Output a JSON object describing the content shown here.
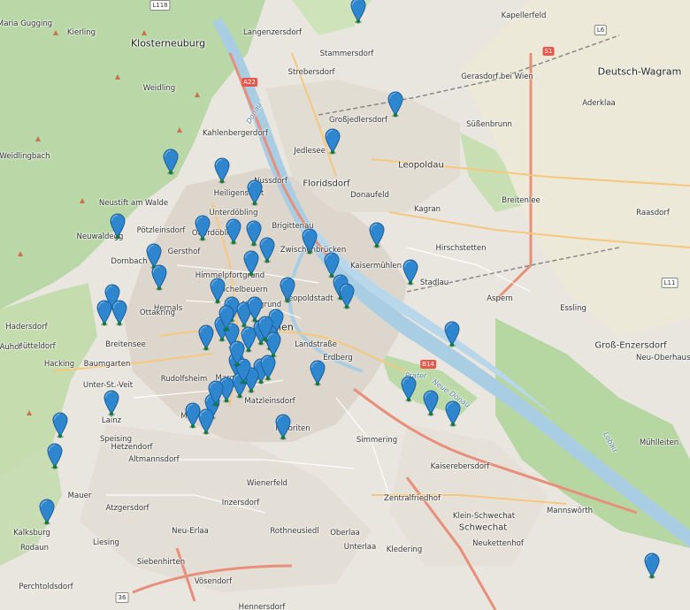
{
  "map": {
    "places": [
      {
        "name": "Maria Gugging",
        "size": "small"
      },
      {
        "name": "Kierling",
        "size": "small"
      },
      {
        "name": "Klosterneuburg",
        "size": "big"
      },
      {
        "name": "Langenzersdorf",
        "size": "small"
      },
      {
        "name": "Kapellerfeld",
        "size": "small"
      },
      {
        "name": "Stammersdorf",
        "size": "small"
      },
      {
        "name": "Strebersdorf",
        "size": "small"
      },
      {
        "name": "Gerasdorf bei Wien",
        "size": "small"
      },
      {
        "name": "Deutsch-Wagram",
        "size": "big"
      },
      {
        "name": "Aderklaa",
        "size": "small"
      },
      {
        "name": "Süßenbrunn",
        "size": "small"
      },
      {
        "name": "Großjedlersdorf",
        "size": "small"
      },
      {
        "name": "Weidling",
        "size": "small"
      },
      {
        "name": "Kahlenbergerdorf",
        "size": "small"
      },
      {
        "name": "Jedlesee",
        "size": "small"
      },
      {
        "name": "Leopoldau",
        "size": "mid"
      },
      {
        "name": "Weidlingbach",
        "size": "small"
      },
      {
        "name": "Neustift am Walde",
        "size": "small"
      },
      {
        "name": "Nussdorf",
        "size": "small"
      },
      {
        "name": "Floridsdorf",
        "size": "mid"
      },
      {
        "name": "Donaufeld",
        "size": "small"
      },
      {
        "name": "Breitenlee",
        "size": "small"
      },
      {
        "name": "Heiligenstadt",
        "size": "small"
      },
      {
        "name": "Unterdöbling",
        "size": "small"
      },
      {
        "name": "Kagran",
        "size": "small"
      },
      {
        "name": "Raasdorf",
        "size": "small"
      },
      {
        "name": "Neuwaldegg",
        "size": "small"
      },
      {
        "name": "Pötzleinsdorf",
        "size": "small"
      },
      {
        "name": "Oberdöbling",
        "size": "small"
      },
      {
        "name": "Brigittenau",
        "size": "small"
      },
      {
        "name": "Zwischenbrücken",
        "size": "small"
      },
      {
        "name": "Hirschstetten",
        "size": "small"
      },
      {
        "name": "Dornbach",
        "size": "small"
      },
      {
        "name": "Gersthof",
        "size": "small"
      },
      {
        "name": "Himmelpfortgrund",
        "size": "small"
      },
      {
        "name": "Kaisermühlen",
        "size": "small"
      },
      {
        "name": "Stadlau",
        "size": "small"
      },
      {
        "name": "Hernals",
        "size": "small"
      },
      {
        "name": "Michelbeuern",
        "size": "small"
      },
      {
        "name": "Leopoldstadt",
        "size": "small"
      },
      {
        "name": "Aspern",
        "size": "small"
      },
      {
        "name": "Ottakring",
        "size": "small"
      },
      {
        "name": "Alsergrund",
        "size": "small"
      },
      {
        "name": "Essling",
        "size": "small"
      },
      {
        "name": "Hütteldorf",
        "size": "small"
      },
      {
        "name": "Breitensee",
        "size": "small"
      },
      {
        "name": "Wien",
        "size": "big"
      },
      {
        "name": "Landstraße",
        "size": "small"
      },
      {
        "name": "Groß-Enzersdorf",
        "size": "mid"
      },
      {
        "name": "Hacking",
        "size": "small"
      },
      {
        "name": "Baumgarten",
        "size": "small"
      },
      {
        "name": "Erdberg",
        "size": "small"
      },
      {
        "name": "Neu-Oberhausen",
        "size": "small"
      },
      {
        "name": "Unter-St.-Veit",
        "size": "small"
      },
      {
        "name": "Rudolfsheim",
        "size": "small"
      },
      {
        "name": "Margareten",
        "size": "small"
      },
      {
        "name": "Matzleinsdorf",
        "size": "small"
      },
      {
        "name": "Lainz",
        "size": "small"
      },
      {
        "name": "Meidling",
        "size": "small"
      },
      {
        "name": "Favoriten",
        "size": "small"
      },
      {
        "name": "Simmering",
        "size": "small"
      },
      {
        "name": "Mühlleiten",
        "size": "small"
      },
      {
        "name": "Speising",
        "size": "small"
      },
      {
        "name": "Hetzendorf",
        "size": "small"
      },
      {
        "name": "Kaiserebersdorf",
        "size": "small"
      },
      {
        "name": "Altmannsdorf",
        "size": "small"
      },
      {
        "name": "Wienerfeld",
        "size": "small"
      },
      {
        "name": "Mauer",
        "size": "small"
      },
      {
        "name": "Inzersdorf",
        "size": "small"
      },
      {
        "name": "Atzgersdorf",
        "size": "small"
      },
      {
        "name": "Zentralfriedhof",
        "size": "small"
      },
      {
        "name": "Klein-Schwechat",
        "size": "small"
      },
      {
        "name": "Mannswörth",
        "size": "small"
      },
      {
        "name": "Schwechat",
        "size": "mid"
      },
      {
        "name": "Kalksburg",
        "size": "small"
      },
      {
        "name": "Neu-Erlaa",
        "size": "small"
      },
      {
        "name": "Rothneusiedl",
        "size": "small"
      },
      {
        "name": "Oberlaa",
        "size": "small"
      },
      {
        "name": "Liesing",
        "size": "small"
      },
      {
        "name": "Neukettenhof",
        "size": "small"
      },
      {
        "name": "Rodaun",
        "size": "small"
      },
      {
        "name": "Siebenhirten",
        "size": "small"
      },
      {
        "name": "Unterlaa",
        "size": "small"
      },
      {
        "name": "Kledering",
        "size": "small"
      },
      {
        "name": "Vösendorf",
        "size": "small"
      },
      {
        "name": "Perchtoldsdorf",
        "size": "small"
      },
      {
        "name": "Hennersdorf",
        "size": "small"
      },
      {
        "name": "Auhof",
        "size": "small"
      },
      {
        "name": "Hadersdorf",
        "size": "small"
      }
    ],
    "road_shields": [
      {
        "label": "L118",
        "kind": "white"
      },
      {
        "label": "L6",
        "kind": "white"
      },
      {
        "label": "S1",
        "kind": "red"
      },
      {
        "label": "A22",
        "kind": "red"
      },
      {
        "label": "L11",
        "kind": "white"
      },
      {
        "label": "B14",
        "kind": "red"
      },
      {
        "label": "36",
        "kind": "white"
      }
    ],
    "feature_labels": [
      "Donau",
      "Neue Donau",
      "Prater",
      "Lobau"
    ],
    "marker_count": 61,
    "marker_color": "#2e86cf",
    "marker_label": "location-marker"
  }
}
